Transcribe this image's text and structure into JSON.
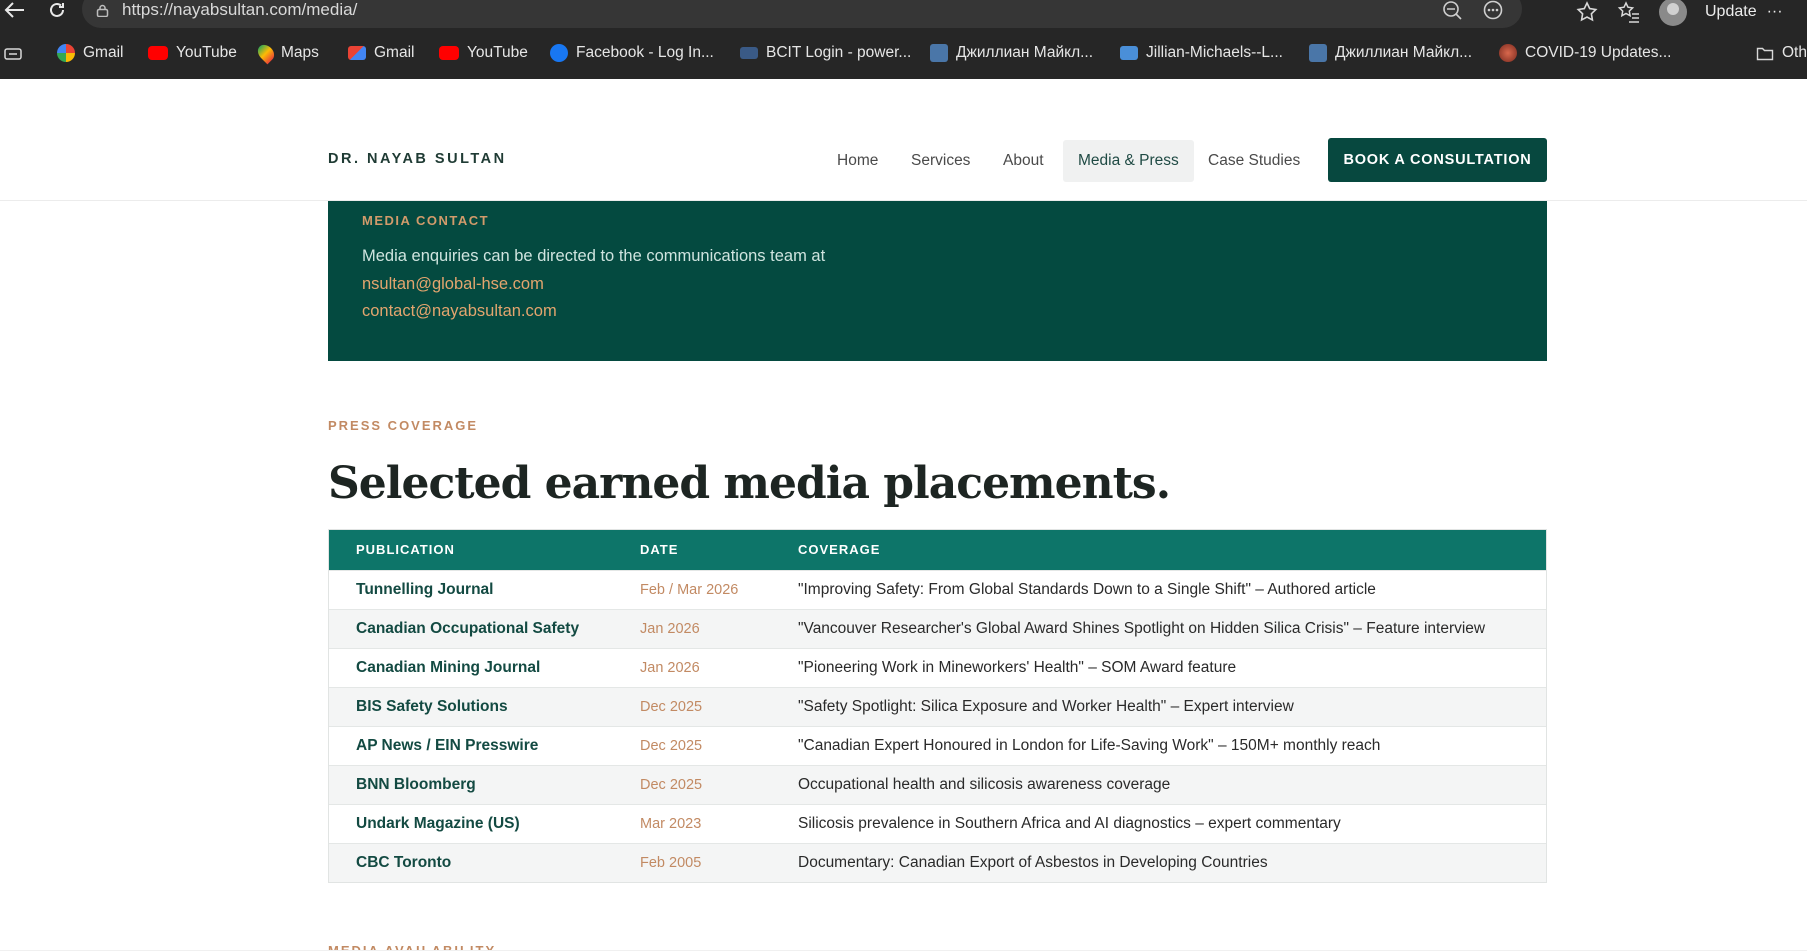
{
  "browser": {
    "url": "https://nayabsultan.com/media/",
    "update_label": "Update",
    "more_label": "···",
    "bookmarks": [
      {
        "label": "Gmail",
        "icon": "google-icon"
      },
      {
        "label": "YouTube",
        "icon": "youtube-icon"
      },
      {
        "label": "Maps",
        "icon": "maps-icon"
      },
      {
        "label": "Gmail",
        "icon": "gmail-icon"
      },
      {
        "label": "YouTube",
        "icon": "youtube-icon"
      },
      {
        "label": "Facebook - Log In...",
        "icon": "facebook-icon"
      },
      {
        "label": "BCIT Login - power...",
        "icon": "bcit-icon"
      },
      {
        "label": "Джиллиан Майкл...",
        "icon": "vk-icon"
      },
      {
        "label": "Jillian-Michaels--L...",
        "icon": "video-icon"
      },
      {
        "label": "Джиллиан Майкл...",
        "icon": "vk-icon"
      },
      {
        "label": "COVID-19 Updates...",
        "icon": "covid-icon"
      },
      {
        "label": "Oth",
        "icon": "folder-icon"
      }
    ]
  },
  "site": {
    "logo": "DR. NAYAB SULTAN",
    "nav": [
      {
        "label": "Home"
      },
      {
        "label": "Services"
      },
      {
        "label": "About"
      },
      {
        "label": "Media & Press",
        "active": true
      },
      {
        "label": "Case Studies"
      }
    ],
    "cta_label": "BOOK A CONSULTATION"
  },
  "media_contact": {
    "eyebrow": "MEDIA CONTACT",
    "text": "Media enquiries can be directed to the communications team at",
    "emails": [
      "nsultan@global-hse.com",
      "contact@nayabsultan.com"
    ]
  },
  "press": {
    "eyebrow": "PRESS COVERAGE",
    "headline": "Selected earned media placements.",
    "columns": [
      "PUBLICATION",
      "DATE",
      "COVERAGE"
    ],
    "rows": [
      {
        "publication": "Tunnelling Journal",
        "date": "Feb / Mar 2026",
        "coverage": "\"Improving Safety: From Global Standards Down to a Single Shift\" – Authored article"
      },
      {
        "publication": "Canadian Occupational Safety",
        "date": "Jan 2026",
        "coverage": "\"Vancouver Researcher's Global Award Shines Spotlight on Hidden Silica Crisis\" – Feature interview"
      },
      {
        "publication": "Canadian Mining Journal",
        "date": "Jan 2026",
        "coverage": "\"Pioneering Work in Mineworkers' Health\" – SOM Award feature"
      },
      {
        "publication": "BIS Safety Solutions",
        "date": "Dec 2025",
        "coverage": "\"Safety Spotlight: Silica Exposure and Worker Health\" – Expert interview"
      },
      {
        "publication": "AP News / EIN Presswire",
        "date": "Dec 2025",
        "coverage": "\"Canadian Expert Honoured in London for Life-Saving Work\" – 150M+ monthly reach"
      },
      {
        "publication": "BNN Bloomberg",
        "date": "Dec 2025",
        "coverage": "Occupational health and silicosis awareness coverage"
      },
      {
        "publication": "Undark Magazine (US)",
        "date": "Mar 2023",
        "coverage": "Silicosis prevalence in Southern Africa and AI diagnostics – expert commentary"
      },
      {
        "publication": "CBC Toronto",
        "date": "Feb 2005",
        "coverage": "Documentary: Canadian Export of Asbestos in Developing Countries"
      }
    ]
  },
  "availability": {
    "eyebrow": "MEDIA AVAILABILITY"
  }
}
